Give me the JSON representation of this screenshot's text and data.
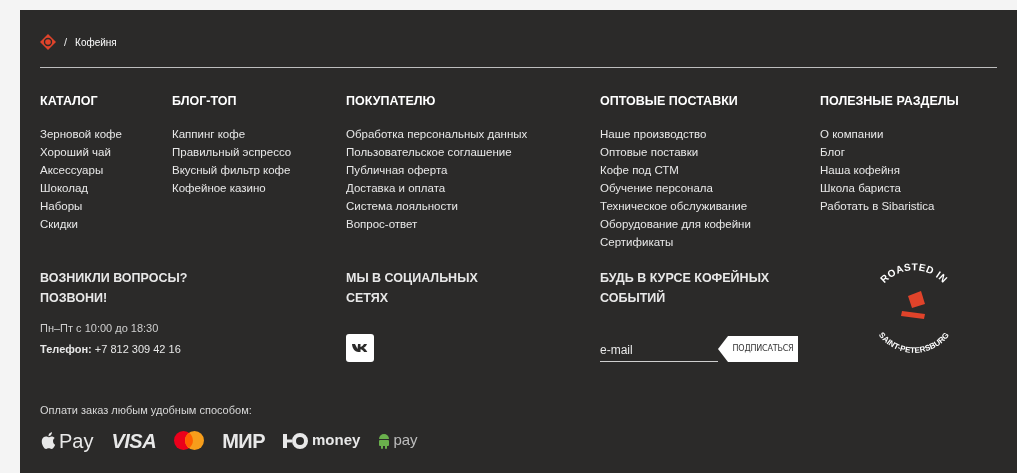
{
  "breadcrumb": {
    "separator": "/",
    "current": "Кофейня"
  },
  "menu_columns": [
    {
      "title": "КАТАЛОГ",
      "links": [
        "Зерновой кофе",
        "Хороший чай",
        "Аксессуары",
        "Шоколад",
        "Наборы",
        "Скидки"
      ]
    },
    {
      "title": "БЛОГ-ТОП",
      "links": [
        "Каппинг кофе",
        "Правильный эспрессо",
        "Вкусный фильтр кофе",
        "Кофейное казино"
      ]
    },
    {
      "title": "ПОКУПАТЕЛЮ",
      "links": [
        "Обработка персональных данных",
        "Пользовательское соглашение",
        "Публичная оферта",
        "Доставка и оплата",
        "Система лояльности",
        "Вопрос-ответ"
      ]
    },
    {
      "title": "ОПТОВЫЕ ПОСТАВКИ",
      "links": [
        "Наше производство",
        "Оптовые поставки",
        "Кофе под СТМ",
        "Обучение персонала",
        "Техническое обслуживание",
        "Оборудование для кофейни",
        "Сертификаты"
      ]
    },
    {
      "title": "ПОЛЕЗНЫЕ РАЗДЕЛЫ",
      "links": [
        "О компании",
        "Блог",
        "Наша кофейня",
        "Школа бариста",
        "Работать в Sibaristica"
      ]
    }
  ],
  "contacts": {
    "title": "ВОЗНИКЛИ ВОПРОСЫ? ПОЗВОНИ!",
    "hours": "Пн–Пт с 10:00 до 18:30",
    "phone": "**Телефон:** +7 812 309 42 16"
  },
  "social": {
    "title": "МЫ В СОЦИАЛЬНЫХ СЕТЯХ"
  },
  "newsletter": {
    "title": "БУДЬ В КУРСЕ КОФЕЙНЫХ СОБЫТИЙ",
    "placeholder": "e-mail",
    "button": "ПОДПИСАТЬСЯ"
  },
  "badge": {
    "top_text": "ROASTED IN",
    "bottom_text": "SAINT-PETERSBURG"
  },
  "payment": {
    "caption": "Оплати заказ любым удобным способом:",
    "methods": [
      {
        "kind": "apple",
        "label": "Pay"
      },
      {
        "kind": "visa",
        "label": "VISA"
      },
      {
        "kind": "mastercard"
      },
      {
        "kind": "mir",
        "label": "МИР"
      },
      {
        "kind": "yoomoney",
        "label": "money"
      },
      {
        "kind": "android",
        "label": "pay"
      }
    ]
  }
}
